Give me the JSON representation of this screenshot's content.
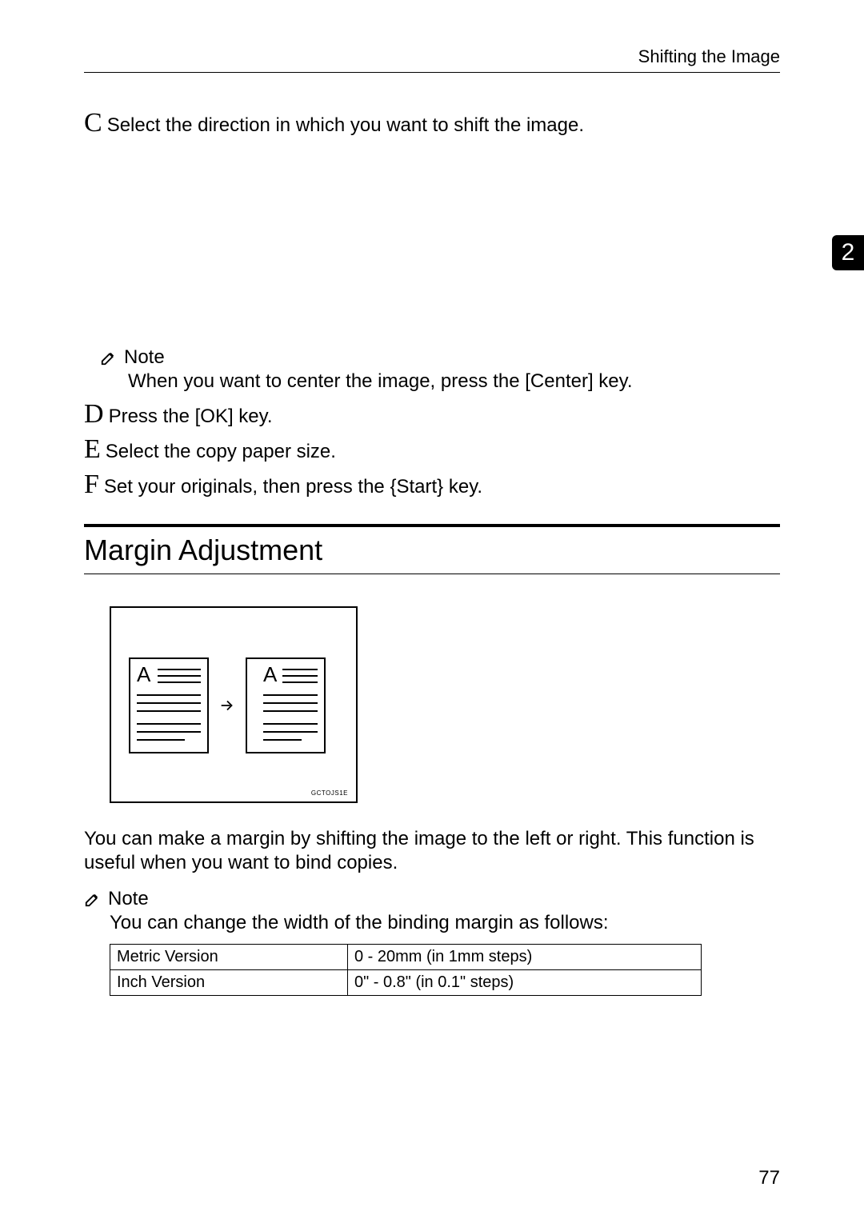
{
  "header": {
    "title": "Shifting the Image"
  },
  "chapter": {
    "number": "2"
  },
  "stepC": {
    "letter": "C",
    "text": "Select the direction in which you want to shift the image."
  },
  "noteC": {
    "label": "Note",
    "text_1": "When you want to center the image, press the ",
    "key": "[Center]",
    "text_2": " key."
  },
  "stepD": {
    "letter": "D",
    "text_1": "Press the ",
    "key": "[OK]",
    "text_2": " key."
  },
  "stepE": {
    "letter": "E",
    "text": "Select the copy paper size."
  },
  "stepF": {
    "letter": "F",
    "text_1": "Set your originals, then press the ",
    "key": "{Start}",
    "text_2": " key."
  },
  "section": {
    "title": "Margin Adjustment"
  },
  "figure": {
    "docLetter": "A",
    "code": "GCTOJS1E"
  },
  "body": {
    "para": "You can make a margin by shifting the image to the left or right. This function is useful when you want to bind copies."
  },
  "note2": {
    "label": "Note",
    "text": "You can change the width of the binding margin as follows:"
  },
  "table": {
    "rows": [
      {
        "version": "Metric Version",
        "range": "0 - 20mm (in 1mm steps)"
      },
      {
        "version": "Inch Version",
        "range": "0\" - 0.8\" (in 0.1\" steps)"
      }
    ]
  },
  "pageNumber": "77"
}
